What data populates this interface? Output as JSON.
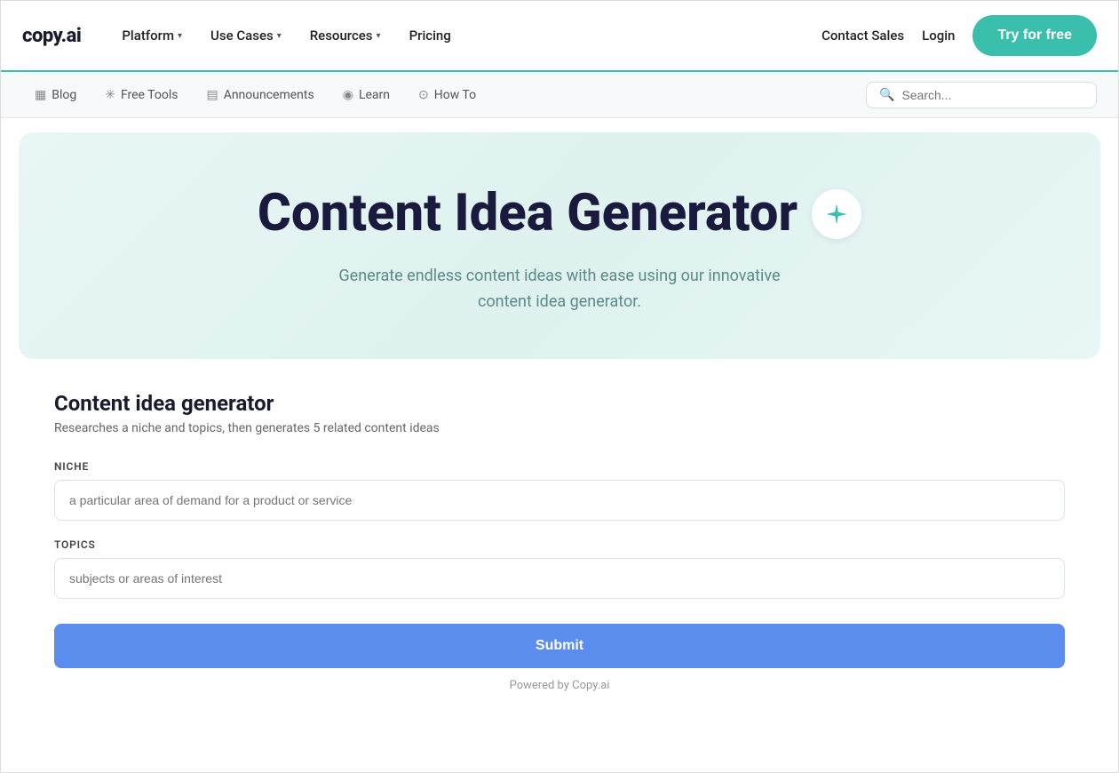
{
  "logo": {
    "text": "copy.ai"
  },
  "navbar": {
    "items": [
      {
        "label": "Platform",
        "has_dropdown": true
      },
      {
        "label": "Use Cases",
        "has_dropdown": true
      },
      {
        "label": "Resources",
        "has_dropdown": true
      },
      {
        "label": "Pricing",
        "has_dropdown": false
      }
    ],
    "right": {
      "contact_sales": "Contact Sales",
      "login": "Login",
      "try_free": "Try for free"
    }
  },
  "sub_navbar": {
    "items": [
      {
        "label": "Blog",
        "icon": "📄"
      },
      {
        "label": "Free Tools",
        "icon": "🔧"
      },
      {
        "label": "Announcements",
        "icon": "📋"
      },
      {
        "label": "Learn",
        "icon": "💡"
      },
      {
        "label": "How To",
        "icon": "⚙️"
      }
    ],
    "search_placeholder": "Search..."
  },
  "hero": {
    "title": "Content Idea Generator",
    "subtitle": "Generate endless content ideas with ease using our innovative content idea generator."
  },
  "form": {
    "title": "Content idea generator",
    "description": "Researches a niche and topics, then generates 5 related content ideas",
    "niche_label": "NICHE",
    "niche_placeholder": "a particular area of demand for a product or service",
    "topics_label": "TOPICS",
    "topics_placeholder": "subjects or areas of interest",
    "submit_label": "Submit",
    "powered_by": "Powered by Copy.ai"
  }
}
